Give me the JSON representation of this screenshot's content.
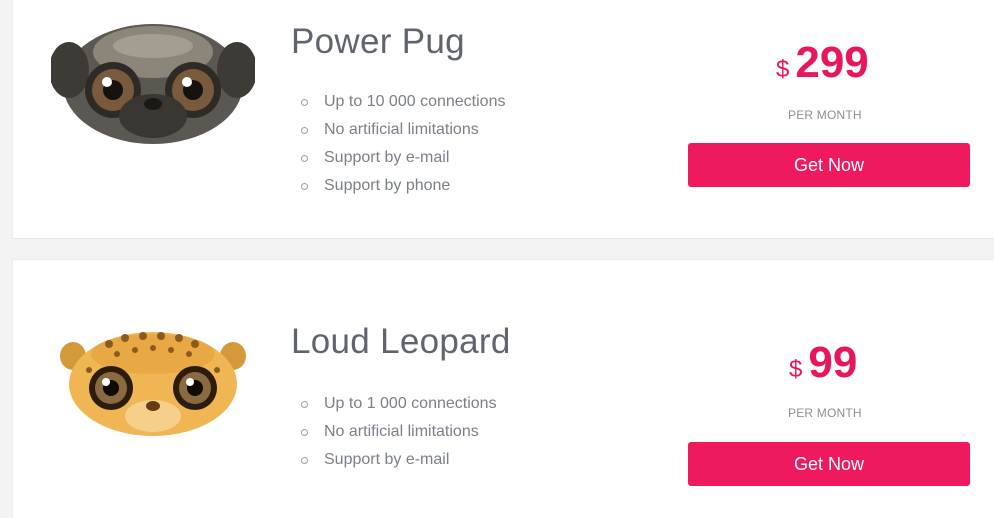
{
  "plans": [
    {
      "avatar": "pug-avatar",
      "title": "Power Pug",
      "features": [
        "Up to 10 000 connections",
        "No artificial limitations",
        "Support by e-mail",
        "Support by phone"
      ],
      "currency": "$",
      "price": "299",
      "period": "PER MONTH",
      "cta": "Get Now"
    },
    {
      "avatar": "leopard-avatar",
      "title": "Loud Leopard",
      "features": [
        "Up to 1 000 connections",
        "No artificial limitations",
        "Support by e-mail"
      ],
      "currency": "$",
      "price": "99",
      "period": "PER MONTH",
      "cta": "Get Now"
    }
  ],
  "colors": {
    "accent": "#ee1a5d",
    "price": "#e8175d",
    "title": "#5f6470",
    "text": "#7a7f89"
  }
}
